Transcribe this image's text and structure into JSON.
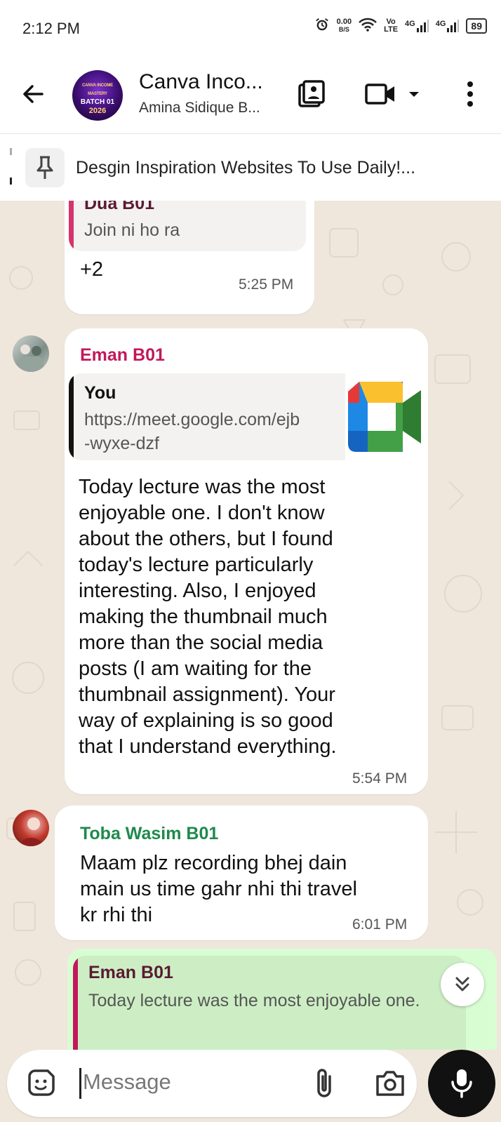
{
  "status_bar": {
    "time": "2:12 PM",
    "speed_value": "0.00",
    "speed_unit": "B/S",
    "volte_top": "Vo",
    "volte_bottom": "LTE",
    "net1": "4G",
    "net2": "4G",
    "battery": "89"
  },
  "header": {
    "title": "Canva Inco...",
    "subtitle": "Amina Sidique B...",
    "avatar_line1": "CANVA INCOME MASTERY",
    "avatar_line2": "BATCH 01",
    "avatar_line3": "2026"
  },
  "pinned": {
    "text": "Desgin Inspiration Websites To Use Daily!..."
  },
  "messages": [
    {
      "quote_name": "Dua B01",
      "quote_text": "Join ni ho ra",
      "text": "+2",
      "time": "5:25 PM"
    },
    {
      "sender": "Eman B01",
      "quote_name": "You",
      "quote_text_1": "https://meet.google.com/ejb",
      "quote_text_2": "-wyxe-dzf",
      "lines": [
        "Today lecture was the most",
        "enjoyable one. I don't know",
        "about the others, but I found",
        "today's lecture particularly",
        "interesting. Also, I enjoyed",
        "making the thumbnail much",
        "more than the social media",
        "posts (I am waiting for the",
        "thumbnail assignment). Your",
        "way of explaining is so good",
        "that I understand everything."
      ],
      "time": "5:54 PM"
    },
    {
      "sender": "Toba Wasim B01",
      "lines": [
        "Maam plz recording bhej dain",
        "main us time gahr nhi thi travel",
        "kr rhi thi"
      ],
      "time": "6:01 PM"
    },
    {
      "quote_name": "Eman B01",
      "quote_text": "Today lecture was the most enjoyable one."
    }
  ],
  "composer": {
    "placeholder": "Message"
  },
  "colors": {
    "dua": "#d6336c",
    "eman": "#c2185b",
    "toba": "#1e8a4c",
    "outgoing": "#d9fdd3",
    "chat_bg": "#efe7dc"
  }
}
